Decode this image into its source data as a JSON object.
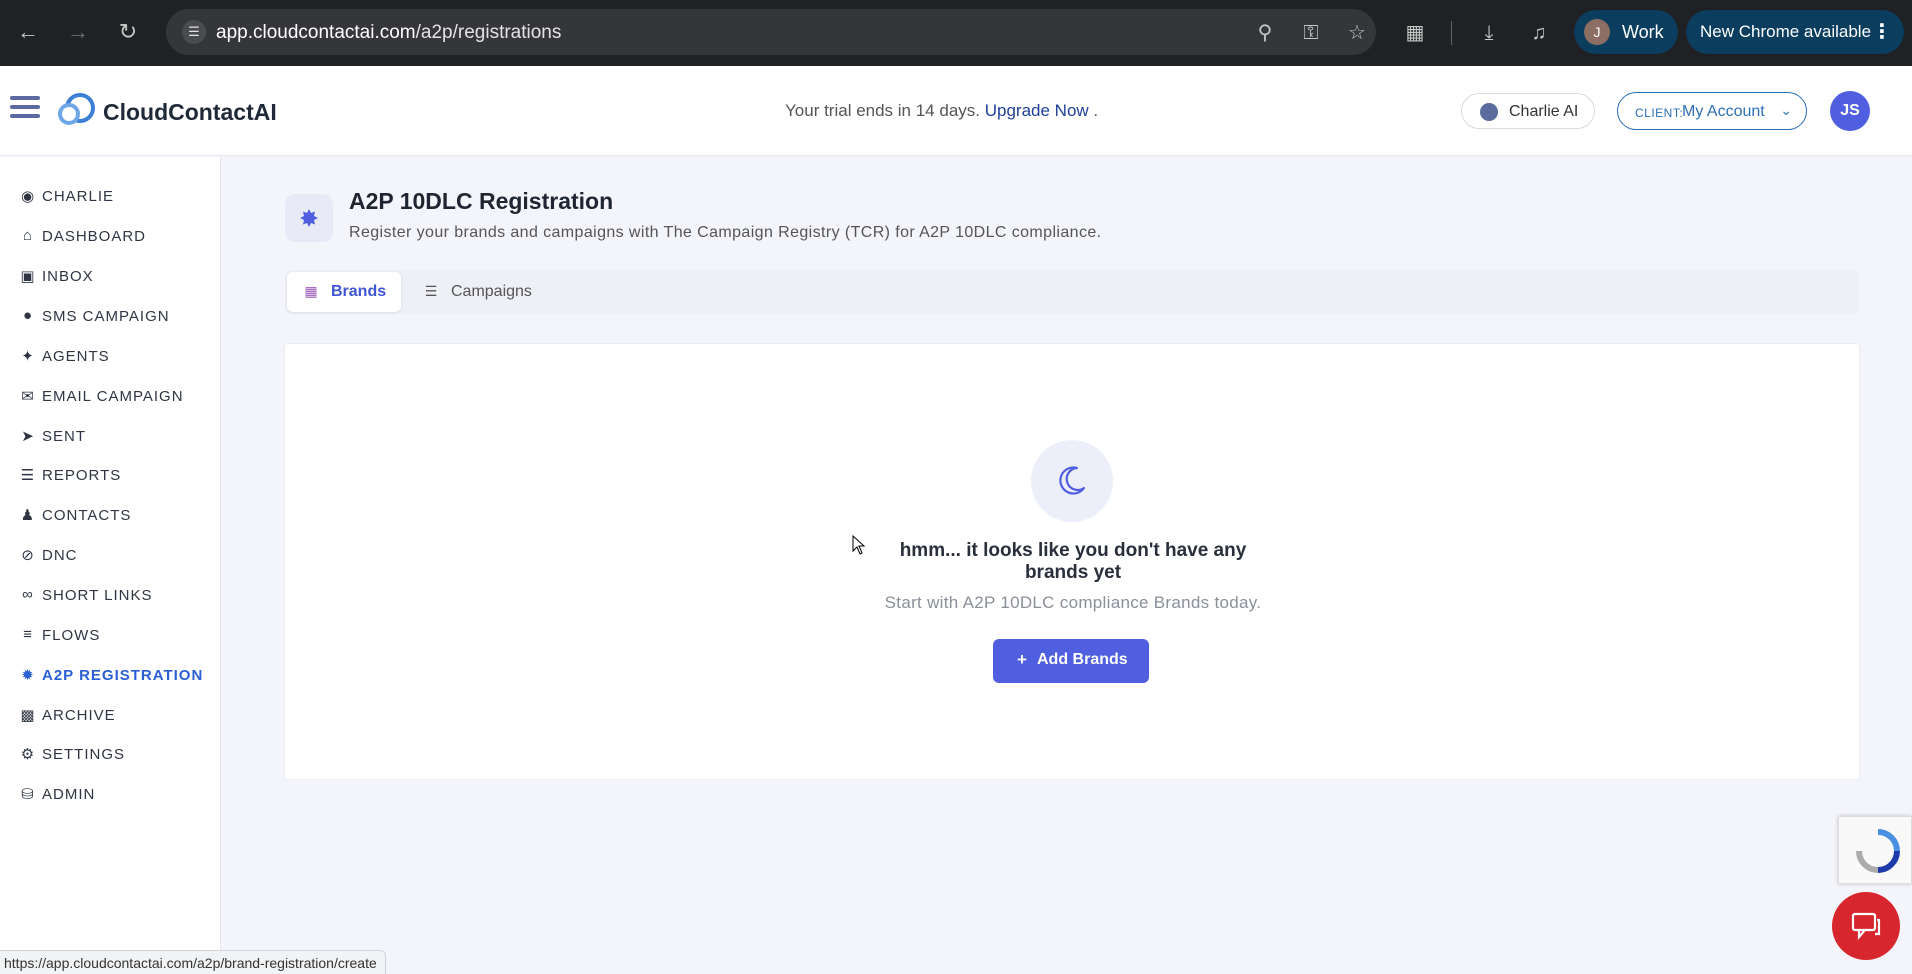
{
  "browser": {
    "url_host": "app.cloudcontactai.com",
    "url_path": "/a2p/registrations",
    "profile_initial": "J",
    "profile_label": "Work",
    "update_label": "New Chrome available"
  },
  "header": {
    "logo_text": "CloudContactAI",
    "trial_text": "Your trial ends in 14 days.",
    "upgrade_link": "Upgrade Now",
    "trial_suffix": ".",
    "charlie_label": "Charlie AI",
    "client_prefix": "CLIENT:",
    "client_value": "My Account",
    "user_initials": "JS"
  },
  "sidebar": {
    "items": [
      {
        "label": "CHARLIE",
        "icon": "robot-icon"
      },
      {
        "label": "DASHBOARD",
        "icon": "home-icon"
      },
      {
        "label": "INBOX",
        "icon": "inbox-icon"
      },
      {
        "label": "SMS CAMPAIGN",
        "icon": "chat-icon"
      },
      {
        "label": "AGENTS",
        "icon": "wand-icon"
      },
      {
        "label": "EMAIL CAMPAIGN",
        "icon": "envelope-icon"
      },
      {
        "label": "SENT",
        "icon": "paper-plane-icon"
      },
      {
        "label": "REPORTS",
        "icon": "list-icon"
      },
      {
        "label": "CONTACTS",
        "icon": "user-icon"
      },
      {
        "label": "DNC",
        "icon": "ban-icon"
      },
      {
        "label": "SHORT LINKS",
        "icon": "link-icon"
      },
      {
        "label": "FLOWS",
        "icon": "sliders-icon"
      },
      {
        "label": "A2P REGISTRATION",
        "icon": "badge-icon"
      },
      {
        "label": "ARCHIVE",
        "icon": "archive-icon"
      },
      {
        "label": "SETTINGS",
        "icon": "gear-icon"
      },
      {
        "label": "ADMIN",
        "icon": "database-icon"
      }
    ]
  },
  "page": {
    "title": "A2P 10DLC Registration",
    "subtitle": "Register your brands and campaigns with The Campaign Registry (TCR) for A2P 10DLC compliance.",
    "tabs": [
      {
        "label": "Brands"
      },
      {
        "label": "Campaigns"
      }
    ],
    "empty_title": "hmm... it looks like you don't have any brands yet",
    "empty_subtitle": "Start with A2P 10DLC compliance Brands today.",
    "add_button": "Add Brands"
  },
  "status_bar": {
    "hover_url": "https://app.cloudcontactai.com/a2p/brand-registration/create"
  },
  "colors": {
    "accent": "#4f5fe0",
    "active_nav": "#2a5fd6",
    "chrome_bg": "#202124"
  }
}
